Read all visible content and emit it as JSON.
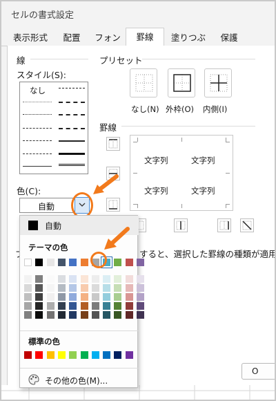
{
  "window": {
    "title": "セルの書式設定"
  },
  "tabs": [
    {
      "label": "表示形式",
      "active": false
    },
    {
      "label": "配置",
      "active": false
    },
    {
      "label": "フォント",
      "active": false
    },
    {
      "label": "罫線",
      "active": true
    },
    {
      "label": "塗りつぶし",
      "active": false
    },
    {
      "label": "保護",
      "active": false
    }
  ],
  "line_group": {
    "title": "線",
    "style_label": "スタイル(S):",
    "none_label": "なし",
    "color_label": "色(C):",
    "color_value": "自動"
  },
  "preset_group": {
    "title": "プリセット",
    "buttons": [
      {
        "label": "なし(N)",
        "icon": "preset-none-icon"
      },
      {
        "label": "外枠(O)",
        "icon": "preset-outline-icon"
      },
      {
        "label": "内側(I)",
        "icon": "preset-inside-icon"
      }
    ]
  },
  "border_group": {
    "title": "罫線",
    "preview_cells": [
      "文字列",
      "文字列",
      "文字列",
      "文字列"
    ]
  },
  "description": {
    "head": "プ",
    "tail": "すると、選択した罫線の種類が適用されます"
  },
  "ok_label": "O",
  "color_popup": {
    "automatic_label": "自動",
    "theme_title": "テーマの色",
    "standard_title": "標準の色",
    "more_colors_label": "その他の色(M)...",
    "theme_colors": [
      "#ffffff",
      "#000000",
      "#e7e6e6",
      "#44546a",
      "#4472c4",
      "#ed7d31",
      "#a5a5a5",
      "#4bacc6",
      "#70ad47",
      "#c0504d",
      "#8064a2"
    ],
    "selected_theme_index": 7,
    "standard_colors": [
      "#c00000",
      "#ff0000",
      "#ffc000",
      "#ffff00",
      "#92d050",
      "#00b050",
      "#00b0f0",
      "#0070c0",
      "#002060",
      "#7030a0"
    ]
  },
  "accent": {
    "annotation_orange": "#f27a1c",
    "selection_blue": "#4a8fd8"
  }
}
